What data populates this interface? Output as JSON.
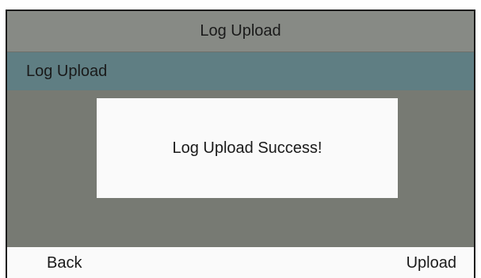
{
  "screen": {
    "title": "Log Upload",
    "selected_item": "Log Upload"
  },
  "dialog": {
    "message": "Log Upload Success!"
  },
  "softkeys": {
    "left": "Back",
    "right": "Upload"
  },
  "colors": {
    "title_bar": "#878a85",
    "selected_row": "#5f7e83",
    "background": "#777a73",
    "dialog": "#fafafa",
    "softkey_bar": "#fafafa",
    "text": "#1a1a1a"
  }
}
